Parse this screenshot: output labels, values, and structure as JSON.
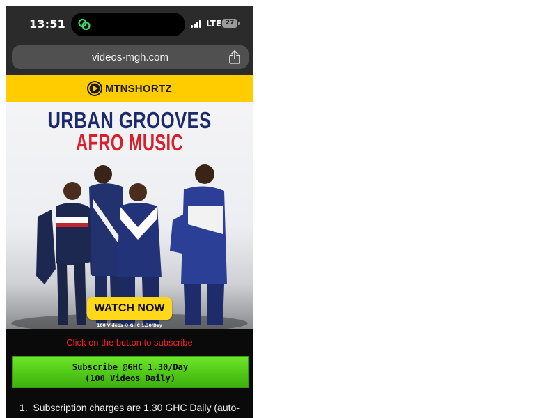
{
  "status_bar": {
    "time": "13:51",
    "network": "LTE",
    "battery": "27"
  },
  "browser": {
    "url": "videos-mgh.com"
  },
  "brand": {
    "name_bold": "MTN",
    "name_rest": "SHORTZ",
    "color": "#ffcc00"
  },
  "banner": {
    "title_line1": "URBAN GROOVES",
    "title_line2": "AFRO MUSIC",
    "button_label": "WATCH NOW",
    "caption": "100 Videos @ GHC 1.30/Day"
  },
  "instruction": "Click on the button to subscribe",
  "subscribe": {
    "line1": "Subscribe @GHC 1.30/Day",
    "line2": "(100 Videos Daily)"
  },
  "terms": [
    {
      "number": "1.",
      "text": "Subscription charges are 1.30 GHC Daily (auto-"
    }
  ],
  "colors": {
    "accent_green": "#4fc817",
    "instruction_red": "#ff1a1a",
    "title_navy": "#1c2a6b",
    "title_red": "#d8202c"
  }
}
